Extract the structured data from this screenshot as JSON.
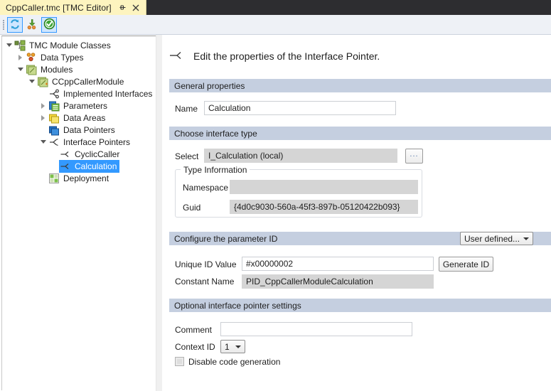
{
  "window": {
    "tab": {
      "title": "CppCaller.tmc [TMC Editor]",
      "pin_icon": "pin-icon",
      "close_icon": "close-icon"
    }
  },
  "toolbar": {
    "buttons": [
      {
        "name": "refresh-button",
        "icon": "refresh-icon",
        "selected": true
      },
      {
        "name": "import-button",
        "icon": "download-arrow-icon",
        "selected": false
      },
      {
        "name": "validate-button",
        "icon": "green-check-icon",
        "selected": true
      }
    ]
  },
  "tree": {
    "nodes": [
      {
        "label": "TMC Module Classes",
        "depth": 0,
        "twisty": "collapse",
        "icon": "module-classes-icon",
        "selected": false
      },
      {
        "label": "Data Types",
        "depth": 1,
        "twisty": "expand",
        "icon": "data-types-icon",
        "selected": false
      },
      {
        "label": "Modules",
        "depth": 1,
        "twisty": "collapse",
        "icon": "modules-icon",
        "selected": false
      },
      {
        "label": "CCppCallerModule",
        "depth": 2,
        "twisty": "collapse",
        "icon": "module-icon",
        "selected": false
      },
      {
        "label": "Implemented Interfaces",
        "depth": 3,
        "twisty": "none",
        "icon": "interfaces-icon",
        "selected": false
      },
      {
        "label": "Parameters",
        "depth": 3,
        "twisty": "expand",
        "icon": "parameters-icon",
        "selected": false
      },
      {
        "label": "Data Areas",
        "depth": 3,
        "twisty": "expand",
        "icon": "data-areas-icon",
        "selected": false
      },
      {
        "label": "Data Pointers",
        "depth": 3,
        "twisty": "none",
        "icon": "data-pointers-icon",
        "selected": false
      },
      {
        "label": "Interface Pointers",
        "depth": 3,
        "twisty": "collapse",
        "icon": "interface-pointers-icon",
        "selected": false
      },
      {
        "label": "CyclicCaller",
        "depth": 4,
        "twisty": "none",
        "icon": "interface-pointer-icon",
        "selected": false
      },
      {
        "label": "Calculation",
        "depth": 4,
        "twisty": "none",
        "icon": "interface-pointer-icon",
        "selected": true
      },
      {
        "label": "Deployment",
        "depth": 3,
        "twisty": "none",
        "icon": "deployment-icon",
        "selected": false
      }
    ]
  },
  "page": {
    "heading": "Edit the properties of the Interface Pointer.",
    "heading_icon": "interface-pointer-icon",
    "sections": {
      "general": {
        "title": "General properties",
        "name_label": "Name",
        "name_value": "Calculation"
      },
      "interface_type": {
        "title": "Choose interface type",
        "select_label": "Select",
        "select_value": "I_Calculation (local)",
        "browse_button": "...",
        "type_info": {
          "title": "Type Information",
          "namespace_label": "Namespace",
          "namespace_value": "",
          "guid_label": "Guid",
          "guid_value": "{4d0c9030-560a-45f3-897b-05120422b093}"
        }
      },
      "parameter_id": {
        "title": "Configure the parameter ID",
        "mode_value": "User defined...",
        "mode_options": [
          "User defined..."
        ],
        "unique_id_label": "Unique ID Value",
        "unique_id_value": "#x00000002",
        "generate_button": "Generate ID",
        "constant_name_label": "Constant Name",
        "constant_name_value": "PID_CppCallerModuleCalculation"
      },
      "optional": {
        "title": "Optional interface pointer settings",
        "comment_label": "Comment",
        "comment_value": "",
        "comment_placeholder": "",
        "context_id_label": "Context ID",
        "context_id_value": "1",
        "context_id_options": [
          "1"
        ],
        "disable_codegen_label": "Disable code generation",
        "disable_codegen_checked": false
      }
    }
  },
  "colors": {
    "tab_background": "#fdf4bf",
    "titlebar": "#2d2d30",
    "section_header": "#c5cfe0",
    "selection": "#3399ff",
    "readonly_field": "#d5d5d5"
  }
}
